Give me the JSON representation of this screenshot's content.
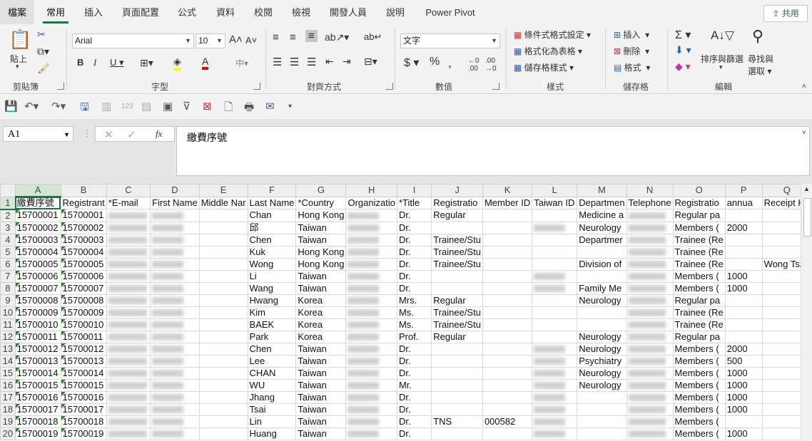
{
  "tabs": [
    "檔案",
    "常用",
    "插入",
    "頁面配置",
    "公式",
    "資料",
    "校閱",
    "檢視",
    "開發人員",
    "說明",
    "Power Pivot"
  ],
  "share_label": "共用",
  "ribbon": {
    "paste": "貼上",
    "font_name": "Arial",
    "font_size": "10",
    "number_format": "文字",
    "cond_format": "條件式格式設定",
    "format_table": "格式化為表格",
    "cell_style": "儲存格樣式",
    "insert": "插入",
    "delete": "刪除",
    "format": "格式",
    "sort_filter": "排序與篩選",
    "find_select_1": "尋找與",
    "find_select_2": "選取",
    "groups": [
      "剪貼簿",
      "字型",
      "對齊方式",
      "數值",
      "樣式",
      "儲存格",
      "編輯"
    ]
  },
  "name_box": "A1",
  "formula": "繳費序號",
  "columns": [
    "A",
    "B",
    "C",
    "D",
    "E",
    "F",
    "G",
    "H",
    "I",
    "J",
    "K",
    "L",
    "M",
    "N",
    "O",
    "P",
    "Q"
  ],
  "rows": [
    {
      "n": "1",
      "A": "繳費序號",
      "B": "Registrant",
      "C": "*E-mail",
      "D": "First Name",
      "E": "Middle Nar",
      "F": "Last Name",
      "G": "*Country",
      "H": "Organizatio",
      "I": "*Title",
      "J": "Registratio",
      "K": "Member ID",
      "L": "Taiwan ID",
      "M": "Departmen",
      "N": "Telephone",
      "O": "Registratio",
      "P": "annua",
      "Q": "Receipt He"
    },
    {
      "n": "2",
      "A": "15700001",
      "B": "15700001",
      "F": "Chan",
      "G": "Hong Kong",
      "I": "Dr.",
      "J": "Regular",
      "M": "Medicine a",
      "O": "Regular pa"
    },
    {
      "n": "3",
      "A": "15700002",
      "B": "15700002",
      "F": "邱",
      "G": "Taiwan",
      "I": "Dr.",
      "M": "Neurology",
      "O": "Members (",
      "P": "2000"
    },
    {
      "n": "4",
      "A": "15700003",
      "B": "15700003",
      "F": "Chen",
      "G": "Taiwan",
      "I": "Dr.",
      "J": "Trainee/Stu",
      "M": "Departmer",
      "O": "Trainee (Re"
    },
    {
      "n": "5",
      "A": "15700004",
      "B": "15700004",
      "F": "Kuk",
      "G": "Hong Kong",
      "I": "Dr.",
      "J": "Trainee/Stu",
      "O": "Trainee (Re"
    },
    {
      "n": "6",
      "A": "15700005",
      "B": "15700005",
      "F": "Wong",
      "G": "Hong Kong",
      "I": "Dr.",
      "J": "Trainee/Stu",
      "M": "Division of",
      "O": "Trainee (Re",
      "Q": "Wong Tsz"
    },
    {
      "n": "7",
      "A": "15700006",
      "B": "15700006",
      "F": "Li",
      "G": "Taiwan",
      "I": "Dr.",
      "O": "Members (",
      "P": "1000"
    },
    {
      "n": "8",
      "A": "15700007",
      "B": "15700007",
      "F": "Wang",
      "G": "Taiwan",
      "I": "Dr.",
      "M": "Family Me",
      "O": "Members (",
      "P": "1000"
    },
    {
      "n": "9",
      "A": "15700008",
      "B": "15700008",
      "F": "Hwang",
      "G": "Korea",
      "I": "Mrs.",
      "J": "Regular",
      "M": "Neurology",
      "O": "Regular pa"
    },
    {
      "n": "10",
      "A": "15700009",
      "B": "15700009",
      "F": "Kim",
      "G": "Korea",
      "I": "Ms.",
      "J": "Trainee/Stu",
      "O": "Trainee (Re"
    },
    {
      "n": "11",
      "A": "15700010",
      "B": "15700010",
      "F": "BAEK",
      "G": "Korea",
      "I": "Ms.",
      "J": "Trainee/Stu",
      "O": "Trainee (Re"
    },
    {
      "n": "12",
      "A": "15700011",
      "B": "15700011",
      "F": "Park",
      "G": "Korea",
      "I": "Prof.",
      "J": "Regular",
      "M": "Neurology",
      "O": "Regular pa"
    },
    {
      "n": "13",
      "A": "15700012",
      "B": "15700012",
      "F": "Chen",
      "G": "Taiwan",
      "I": "Dr.",
      "M": "Neurology",
      "O": "Members (",
      "P": "2000"
    },
    {
      "n": "14",
      "A": "15700013",
      "B": "15700013",
      "F": "Lee",
      "G": "Taiwan",
      "I": "Dr.",
      "M": "Psychiatry",
      "O": "Members (",
      "P": "500"
    },
    {
      "n": "15",
      "A": "15700014",
      "B": "15700014",
      "F": "CHAN",
      "G": "Taiwan",
      "I": "Dr.",
      "M": "Neurology",
      "O": "Members (",
      "P": "1000"
    },
    {
      "n": "16",
      "A": "15700015",
      "B": "15700015",
      "F": "WU",
      "G": "Taiwan",
      "I": "Mr.",
      "M": "Neurology",
      "O": "Members (",
      "P": "1000"
    },
    {
      "n": "17",
      "A": "15700016",
      "B": "15700016",
      "F": "Jhang",
      "G": "Taiwan",
      "I": "Dr.",
      "O": "Members (",
      "P": "1000"
    },
    {
      "n": "18",
      "A": "15700017",
      "B": "15700017",
      "F": "Tsai",
      "G": "Taiwan",
      "I": "Dr.",
      "O": "Members (",
      "P": "1000"
    },
    {
      "n": "19",
      "A": "15700018",
      "B": "15700018",
      "F": "Lin",
      "G": "Taiwan",
      "I": "Dr.",
      "J": "TNS",
      "K": "000582",
      "O": "Members ("
    },
    {
      "n": "20",
      "A": "15700019",
      "B": "15700019",
      "F": "Huang",
      "G": "Taiwan",
      "I": "Dr.",
      "O": "Members (",
      "P": "1000"
    }
  ]
}
